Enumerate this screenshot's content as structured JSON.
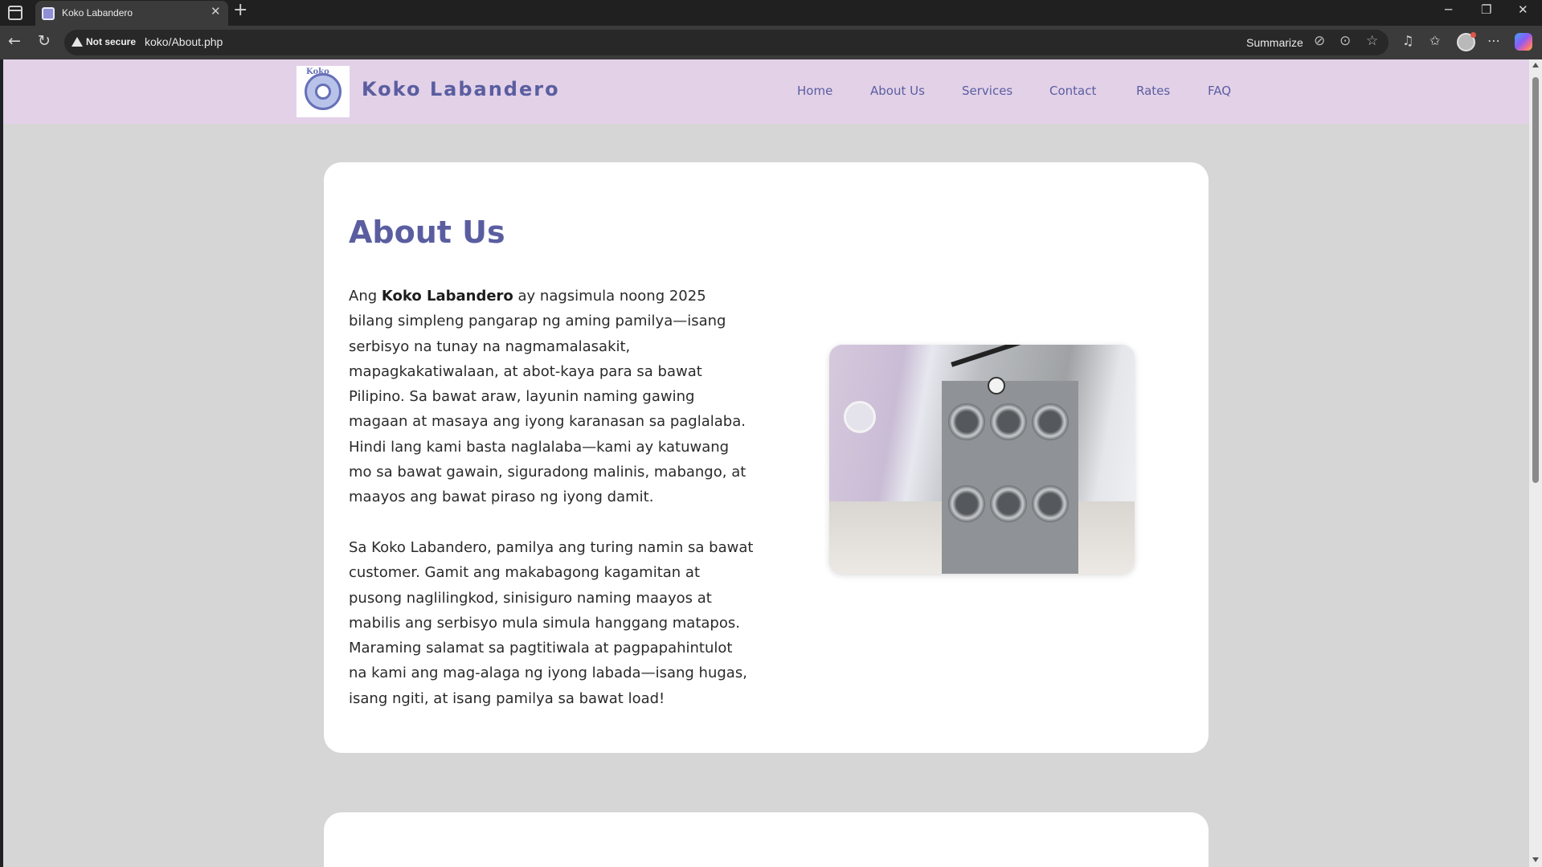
{
  "browser": {
    "tab_title": "Koko Labandero",
    "tab_close": "✕",
    "new_tab": "+",
    "not_secure": "Not secure",
    "url": "koko/About.php",
    "summarize": "Summarize",
    "window_controls": [
      "─",
      "❐",
      "✕"
    ]
  },
  "site": {
    "brand": "Koko Labandero",
    "logo_text": "Koko",
    "nav": [
      "Home",
      "About Us",
      "Services",
      "Contact",
      "Rates",
      "FAQ"
    ]
  },
  "about": {
    "title": "About Us",
    "p1_start": "Ang ",
    "p1_bold": "Koko Labandero",
    "p1_rest": " ay nagsimula noong 2025 bilang simpleng pangarap ng aming pamilya—isang serbisyo na tunay na nagmamalasakit, mapagkakatiwalaan, at abot-kaya para sa bawat Pilipino. Sa bawat araw, layunin naming gawing magaan at masaya ang iyong karanasan sa paglalaba. Hindi lang kami basta naglalaba—kami ay katuwang mo sa bawat gawain, siguradong malinis, mabango, at maayos ang bawat piraso ng iyong damit.",
    "p2": "Sa Koko Labandero, pamilya ang turing namin sa bawat customer. Gamit ang makabagong kagamitan at pusong naglilingkod, sinisiguro naming maayos at mabilis ang serbisyo mula simula hanggang matapos. Maraming salamat sa pagtitiwala at pagpapahintulot na kami ang mag-alaga ng iyong labada—isang hugas, isang ngiti, at isang pamilya sa bawat load!"
  },
  "colors": {
    "header_bg": "#e3d1e8",
    "accent": "#5a5ea0",
    "page_bg": "#d6d6d6"
  }
}
